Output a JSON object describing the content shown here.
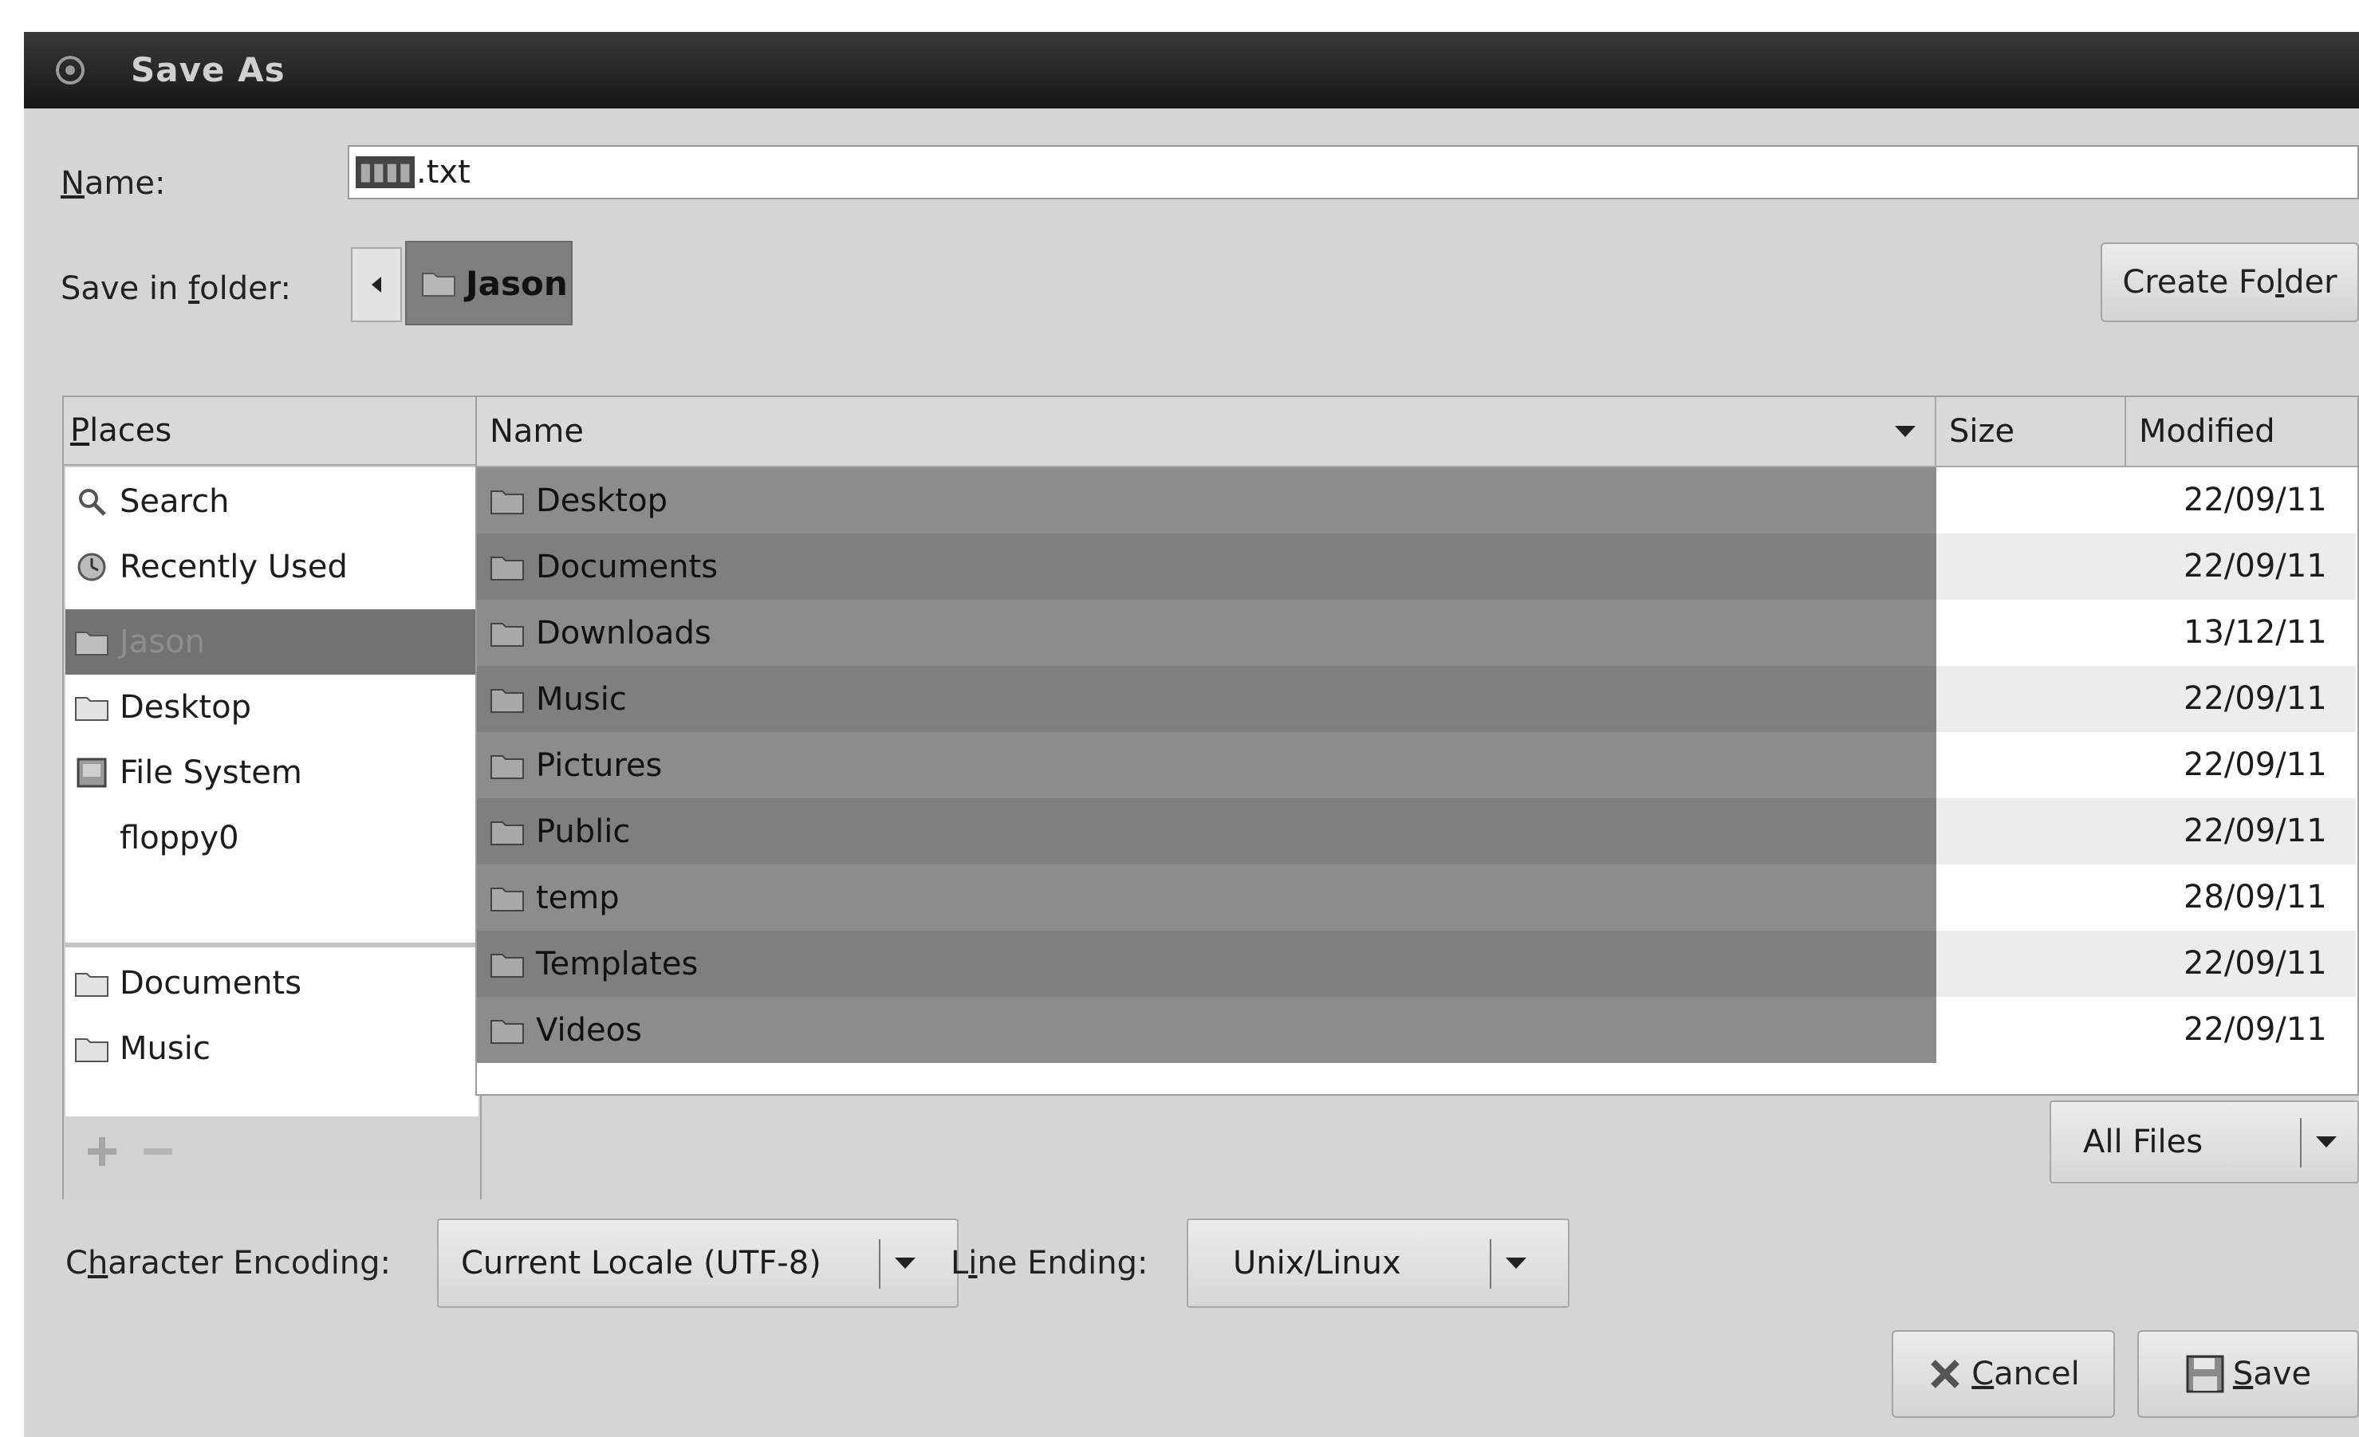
{
  "window": {
    "title": "Save As"
  },
  "name": {
    "label_pre": "",
    "label_u": "N",
    "label_post": "ame:",
    "selected_part": "▮▮▮▮",
    "value": ".txt"
  },
  "folder": {
    "label_pre": "Save in ",
    "label_u": "f",
    "label_post": "older:",
    "current": "Jason"
  },
  "create_folder": {
    "pre": "Create Fo",
    "u": "l",
    "post": "der"
  },
  "places": {
    "header_u": "P",
    "header_post": "laces",
    "items": [
      {
        "label": "Search",
        "icon": "search-icon"
      },
      {
        "label": "Recently Used",
        "icon": "recent-icon"
      },
      {
        "label": "Jason",
        "icon": "home-folder-icon"
      },
      {
        "label": "Desktop",
        "icon": "folder-icon"
      },
      {
        "label": "File System",
        "icon": "drive-icon"
      },
      {
        "label": "floppy0",
        "icon": ""
      },
      {
        "label": "Documents",
        "icon": "folder-icon"
      },
      {
        "label": "Music",
        "icon": "folder-icon"
      }
    ]
  },
  "files": {
    "columns": {
      "name": "Name",
      "size": "Size",
      "modified": "Modified"
    },
    "rows": [
      {
        "name": "Desktop",
        "modified": "22/09/11"
      },
      {
        "name": "Documents",
        "modified": "22/09/11"
      },
      {
        "name": "Downloads",
        "modified": "13/12/11"
      },
      {
        "name": "Music",
        "modified": "22/09/11"
      },
      {
        "name": "Pictures",
        "modified": "22/09/11"
      },
      {
        "name": "Public",
        "modified": "22/09/11"
      },
      {
        "name": "temp",
        "modified": "28/09/11"
      },
      {
        "name": "Templates",
        "modified": "22/09/11"
      },
      {
        "name": "Videos",
        "modified": "22/09/11"
      }
    ]
  },
  "filter": {
    "value": "All Files"
  },
  "encoding": {
    "label_pre": "C",
    "label_u": "h",
    "label_post": "aracter Encoding:",
    "value": "Current Locale (UTF-8)"
  },
  "line_ending": {
    "label_pre": "L",
    "label_u": "i",
    "label_post": "ne Ending:",
    "value": "Unix/Linux"
  },
  "buttons": {
    "cancel_u": "C",
    "cancel_post": "ancel",
    "save_u": "S",
    "save_post": "ave"
  }
}
